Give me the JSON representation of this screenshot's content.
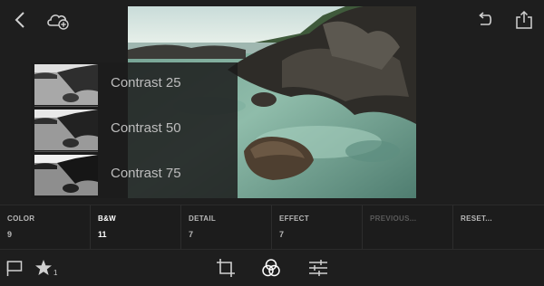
{
  "toolbar": {
    "back_icon": "chevron-left-icon",
    "cloud_icon": "cloud-add-icon",
    "undo_icon": "undo-icon",
    "share_icon": "share-icon"
  },
  "presets": {
    "items": [
      {
        "label": "Contrast 25"
      },
      {
        "label": "Contrast 50"
      },
      {
        "label": "Contrast 75"
      }
    ]
  },
  "categories": [
    {
      "label": "COLOR",
      "count": "9",
      "state": "normal"
    },
    {
      "label": "B&W",
      "count": "11",
      "state": "active"
    },
    {
      "label": "DETAIL",
      "count": "7",
      "state": "normal"
    },
    {
      "label": "EFFECT",
      "count": "7",
      "state": "normal"
    },
    {
      "label": "PREVIOUS...",
      "count": "",
      "state": "disabled"
    },
    {
      "label": "RESET...",
      "count": "",
      "state": "normal"
    }
  ],
  "bottom": {
    "flag_icon": "flag-icon",
    "star_icon": "star-icon",
    "star_count": "1",
    "crop_icon": "crop-icon",
    "presets_icon": "presets-circles-icon",
    "adjust_icon": "sliders-icon"
  },
  "colors": {
    "background": "#1e1e1e",
    "panel": "#1c1c1c",
    "text": "#b8b8b8",
    "active_text": "#ffffff",
    "disabled_text": "#5a5a5a"
  }
}
